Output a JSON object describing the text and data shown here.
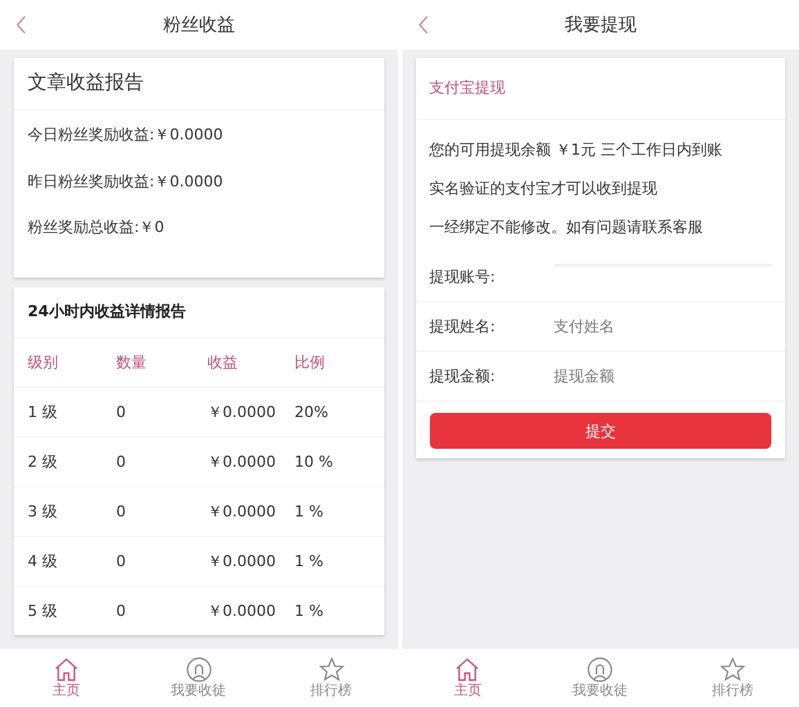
{
  "screens": [
    {
      "kind": "earnings",
      "title": "粉丝收益",
      "report": {
        "title": "文章收益报告",
        "lines": [
          "今日粉丝奖励收益:￥0.0000",
          "昨日粉丝奖励收益:￥0.0000",
          "粉丝奖励总收益:￥0"
        ]
      },
      "detail": {
        "title": "24小时内收益详情报告",
        "columns": [
          "级别",
          "数量",
          "收益",
          "比例"
        ],
        "rows": [
          [
            "1 级",
            "0",
            "￥0.0000",
            "20%"
          ],
          [
            "2 级",
            "0",
            "￥0.0000",
            "10 %"
          ],
          [
            "3 级",
            "0",
            "￥0.0000",
            "1 %"
          ],
          [
            "4 级",
            "0",
            "￥0.0000",
            "1 %"
          ],
          [
            "5 级",
            "0",
            "￥0.0000",
            "1 %"
          ]
        ]
      },
      "tabbar": [
        {
          "label": "主页",
          "selected": true
        },
        {
          "label": "我要收徒",
          "selected": false
        },
        {
          "label": "排行榜",
          "selected": false
        }
      ]
    },
    {
      "kind": "withdraw",
      "title": "我要提现",
      "form": {
        "title": "支付宝提现",
        "notes": [
          "您的可用提现余额 ￥1元 三个工作日内到账",
          "实名验证的支付宝才可以收到提现",
          "一经绑定不能修改。如有问题请联系客服"
        ],
        "fields": [
          {
            "label": "提现账号:"
          },
          {
            "label": "提现姓名:",
            "placeholder": "支付姓名"
          },
          {
            "label": "提现金额:",
            "placeholder": "提现金额"
          }
        ],
        "button": "提交"
      },
      "tabbar": [
        {
          "label": "主页",
          "selected": true
        },
        {
          "label": "我要收徒",
          "selected": false
        },
        {
          "label": "排行榜",
          "selected": false
        }
      ]
    }
  ]
}
